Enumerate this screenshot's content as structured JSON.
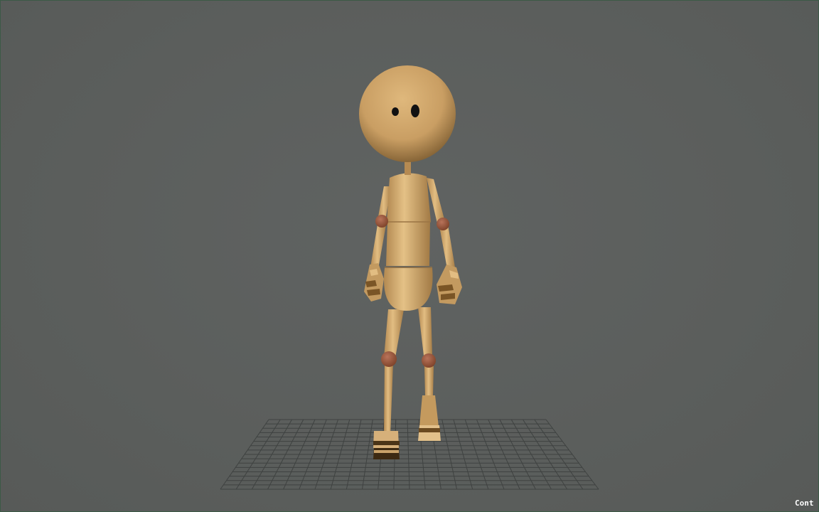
{
  "viewport": {
    "hud_label": "Cont",
    "background_color": "#5b5e5c",
    "grid_color": "#3f4241"
  },
  "character": {
    "skin_color": "#d4aa6c",
    "joint_color": "#9b5a3a",
    "eye_color": "#111111"
  }
}
